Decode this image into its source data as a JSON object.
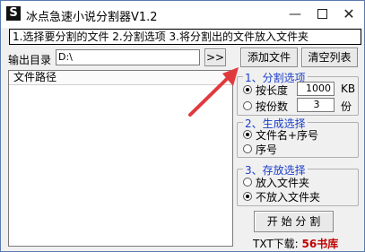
{
  "titlebar": {
    "icon_glyph": "S",
    "title": "冰点急速小说分割器V1.2",
    "minimize_glyph": "—",
    "close_glyph": "✕"
  },
  "instructions": "1.选择要分割的文件 2.分割选项 3.将分割出的文件放入文件夹",
  "output": {
    "label": "输出目录",
    "value": "D:\\",
    "browse_label": ">>"
  },
  "buttons": {
    "add_file": "添加文件",
    "clear_list": "清空列表",
    "start_split": "开 始 分 割"
  },
  "file_list": {
    "header": "文件路径"
  },
  "split_options": {
    "legend": "1、分割选项",
    "by_length_label": "按长度",
    "by_length_value": "1000",
    "by_length_unit": "KB",
    "by_parts_label": "按份数",
    "by_parts_value": "3",
    "by_parts_unit": "份",
    "selected": "by_length"
  },
  "naming": {
    "legend": "2、生成选择",
    "option1": "文件名+序号",
    "option2": "序号",
    "selected": "option1"
  },
  "storage": {
    "legend": "3、存放选择",
    "option1": "放入文件夹",
    "option2": "不放入文件夹",
    "selected": "option2"
  },
  "footer": {
    "prefix": "TXT下载:",
    "brand": "56书库"
  },
  "colors": {
    "annotation_arrow": "#e0393e",
    "legend_text": "#1a3ec8",
    "brand_text": "#c00000"
  }
}
